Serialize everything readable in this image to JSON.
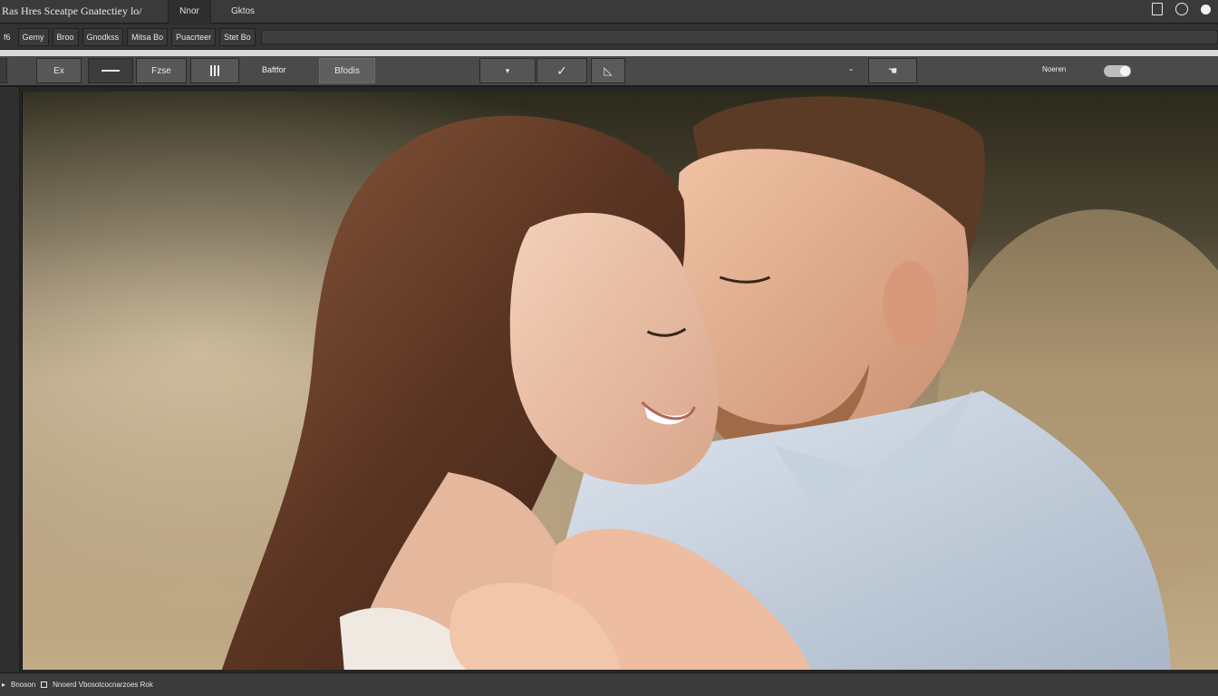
{
  "window": {
    "app_title": "Ras Hres Sceatpe Gnatectiey lo/",
    "tabs": [
      {
        "label": "Nnor",
        "active": true
      },
      {
        "label": "Gktos",
        "active": false
      }
    ],
    "icons": [
      "document-icon",
      "search-circle-icon",
      "account-dot-icon"
    ]
  },
  "menu": {
    "items": [
      "f6",
      "Gemy",
      "Broo",
      "Gnodkss",
      "Mitsa Bo",
      "Puacrteer",
      "Stet Bo"
    ]
  },
  "toolbar": {
    "tools": [
      "Ex",
      "Fzse",
      "Baftfor",
      "Bfodis"
    ],
    "label_right": "Noeren",
    "toggle_on": true
  },
  "canvas": {
    "image_subject": "couple-photo"
  },
  "status": {
    "left": "Bnoson",
    "right": "Nnoerd Vbosotcocnarzoes Rok"
  },
  "colors": {
    "chrome_dark": "#2b2b2b",
    "toolbar": "#4a4a4a",
    "accent_strip": "#d9d9d9"
  }
}
